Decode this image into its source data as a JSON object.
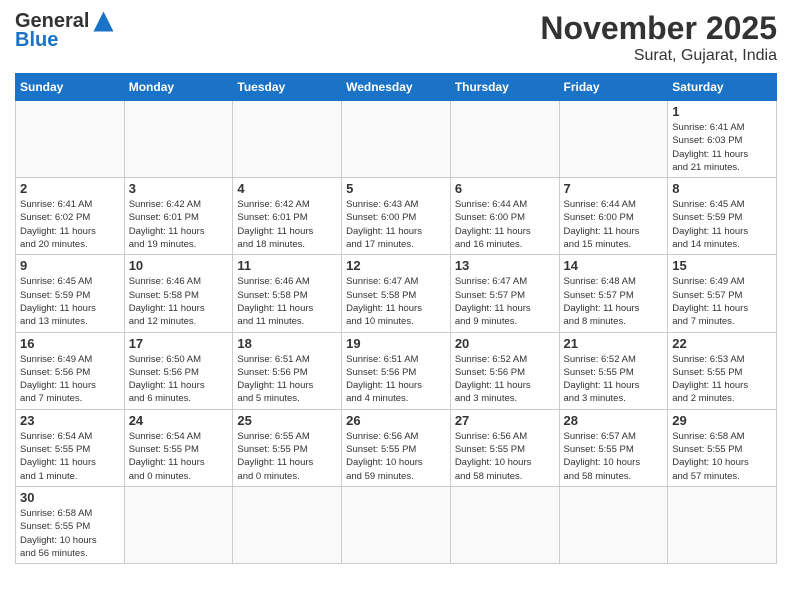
{
  "header": {
    "logo_general": "General",
    "logo_blue": "Blue",
    "title": "November 2025",
    "subtitle": "Surat, Gujarat, India"
  },
  "weekdays": [
    "Sunday",
    "Monday",
    "Tuesday",
    "Wednesday",
    "Thursday",
    "Friday",
    "Saturday"
  ],
  "weeks": [
    [
      {
        "day": null,
        "info": ""
      },
      {
        "day": null,
        "info": ""
      },
      {
        "day": null,
        "info": ""
      },
      {
        "day": null,
        "info": ""
      },
      {
        "day": null,
        "info": ""
      },
      {
        "day": null,
        "info": ""
      },
      {
        "day": "1",
        "info": "Sunrise: 6:41 AM\nSunset: 6:03 PM\nDaylight: 11 hours\nand 21 minutes."
      }
    ],
    [
      {
        "day": "2",
        "info": "Sunrise: 6:41 AM\nSunset: 6:02 PM\nDaylight: 11 hours\nand 20 minutes."
      },
      {
        "day": "3",
        "info": "Sunrise: 6:42 AM\nSunset: 6:01 PM\nDaylight: 11 hours\nand 19 minutes."
      },
      {
        "day": "4",
        "info": "Sunrise: 6:42 AM\nSunset: 6:01 PM\nDaylight: 11 hours\nand 18 minutes."
      },
      {
        "day": "5",
        "info": "Sunrise: 6:43 AM\nSunset: 6:00 PM\nDaylight: 11 hours\nand 17 minutes."
      },
      {
        "day": "6",
        "info": "Sunrise: 6:44 AM\nSunset: 6:00 PM\nDaylight: 11 hours\nand 16 minutes."
      },
      {
        "day": "7",
        "info": "Sunrise: 6:44 AM\nSunset: 6:00 PM\nDaylight: 11 hours\nand 15 minutes."
      },
      {
        "day": "8",
        "info": "Sunrise: 6:45 AM\nSunset: 5:59 PM\nDaylight: 11 hours\nand 14 minutes."
      }
    ],
    [
      {
        "day": "9",
        "info": "Sunrise: 6:45 AM\nSunset: 5:59 PM\nDaylight: 11 hours\nand 13 minutes."
      },
      {
        "day": "10",
        "info": "Sunrise: 6:46 AM\nSunset: 5:58 PM\nDaylight: 11 hours\nand 12 minutes."
      },
      {
        "day": "11",
        "info": "Sunrise: 6:46 AM\nSunset: 5:58 PM\nDaylight: 11 hours\nand 11 minutes."
      },
      {
        "day": "12",
        "info": "Sunrise: 6:47 AM\nSunset: 5:58 PM\nDaylight: 11 hours\nand 10 minutes."
      },
      {
        "day": "13",
        "info": "Sunrise: 6:47 AM\nSunset: 5:57 PM\nDaylight: 11 hours\nand 9 minutes."
      },
      {
        "day": "14",
        "info": "Sunrise: 6:48 AM\nSunset: 5:57 PM\nDaylight: 11 hours\nand 8 minutes."
      },
      {
        "day": "15",
        "info": "Sunrise: 6:49 AM\nSunset: 5:57 PM\nDaylight: 11 hours\nand 7 minutes."
      }
    ],
    [
      {
        "day": "16",
        "info": "Sunrise: 6:49 AM\nSunset: 5:56 PM\nDaylight: 11 hours\nand 7 minutes."
      },
      {
        "day": "17",
        "info": "Sunrise: 6:50 AM\nSunset: 5:56 PM\nDaylight: 11 hours\nand 6 minutes."
      },
      {
        "day": "18",
        "info": "Sunrise: 6:51 AM\nSunset: 5:56 PM\nDaylight: 11 hours\nand 5 minutes."
      },
      {
        "day": "19",
        "info": "Sunrise: 6:51 AM\nSunset: 5:56 PM\nDaylight: 11 hours\nand 4 minutes."
      },
      {
        "day": "20",
        "info": "Sunrise: 6:52 AM\nSunset: 5:56 PM\nDaylight: 11 hours\nand 3 minutes."
      },
      {
        "day": "21",
        "info": "Sunrise: 6:52 AM\nSunset: 5:55 PM\nDaylight: 11 hours\nand 3 minutes."
      },
      {
        "day": "22",
        "info": "Sunrise: 6:53 AM\nSunset: 5:55 PM\nDaylight: 11 hours\nand 2 minutes."
      }
    ],
    [
      {
        "day": "23",
        "info": "Sunrise: 6:54 AM\nSunset: 5:55 PM\nDaylight: 11 hours\nand 1 minute."
      },
      {
        "day": "24",
        "info": "Sunrise: 6:54 AM\nSunset: 5:55 PM\nDaylight: 11 hours\nand 0 minutes."
      },
      {
        "day": "25",
        "info": "Sunrise: 6:55 AM\nSunset: 5:55 PM\nDaylight: 11 hours\nand 0 minutes."
      },
      {
        "day": "26",
        "info": "Sunrise: 6:56 AM\nSunset: 5:55 PM\nDaylight: 10 hours\nand 59 minutes."
      },
      {
        "day": "27",
        "info": "Sunrise: 6:56 AM\nSunset: 5:55 PM\nDaylight: 10 hours\nand 58 minutes."
      },
      {
        "day": "28",
        "info": "Sunrise: 6:57 AM\nSunset: 5:55 PM\nDaylight: 10 hours\nand 58 minutes."
      },
      {
        "day": "29",
        "info": "Sunrise: 6:58 AM\nSunset: 5:55 PM\nDaylight: 10 hours\nand 57 minutes."
      }
    ],
    [
      {
        "day": "30",
        "info": "Sunrise: 6:58 AM\nSunset: 5:55 PM\nDaylight: 10 hours\nand 56 minutes."
      },
      {
        "day": null,
        "info": ""
      },
      {
        "day": null,
        "info": ""
      },
      {
        "day": null,
        "info": ""
      },
      {
        "day": null,
        "info": ""
      },
      {
        "day": null,
        "info": ""
      },
      {
        "day": null,
        "info": ""
      }
    ]
  ]
}
